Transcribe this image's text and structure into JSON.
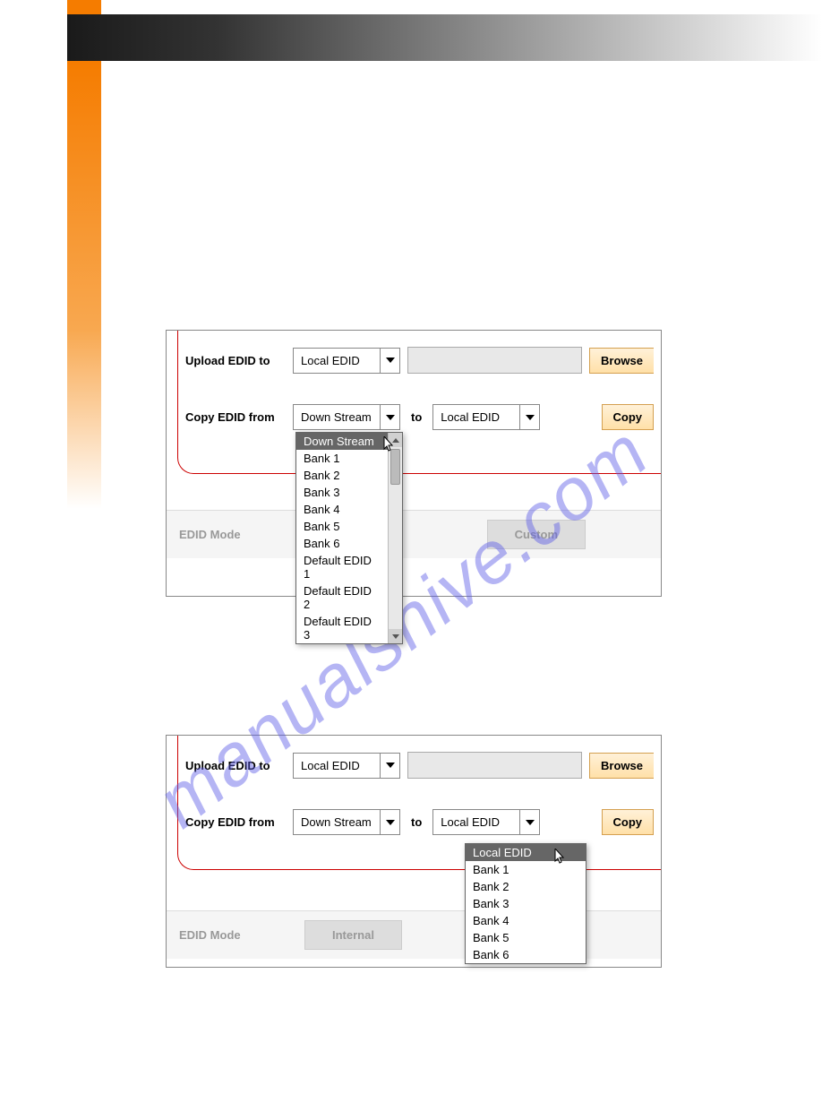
{
  "watermark": "manualshive.com",
  "panel1": {
    "upload_label": "Upload EDID to",
    "upload_select": "Local EDID",
    "browse_btn": "Browse",
    "copy_label": "Copy EDID from",
    "copy_from_select": "Down Stream",
    "to_label": "to",
    "copy_to_select": "Local EDID",
    "copy_btn": "Copy",
    "dropdown_items": [
      "Down Stream",
      "Bank 1",
      "Bank 2",
      "Bank 3",
      "Bank 4",
      "Bank 5",
      "Bank 6",
      "Default EDID 1",
      "Default EDID 2",
      "Default EDID 3"
    ],
    "footer_label": "EDID Mode",
    "footer_btn": "Custom"
  },
  "panel2": {
    "upload_label": "Upload EDID to",
    "upload_select": "Local EDID",
    "browse_btn": "Browse",
    "copy_label": "Copy EDID from",
    "copy_from_select": "Down Stream",
    "to_label": "to",
    "copy_to_select": "Local EDID",
    "copy_btn": "Copy",
    "dropdown_items": [
      "Local EDID",
      "Bank 1",
      "Bank 2",
      "Bank 3",
      "Bank 4",
      "Bank 5",
      "Bank 6"
    ],
    "footer_label": "EDID Mode",
    "footer_btn": "Internal"
  }
}
